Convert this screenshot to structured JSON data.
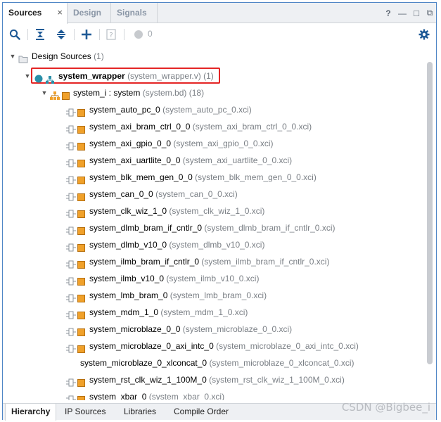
{
  "tabs": [
    {
      "label": "Sources",
      "active": true
    },
    {
      "label": "Design",
      "active": false
    },
    {
      "label": "Signals",
      "active": false
    }
  ],
  "tab_close_glyph": "×",
  "window_controls": {
    "help": "?",
    "minimize": "—",
    "maximize": "□",
    "float": "⧉"
  },
  "toolbar": {
    "icons": [
      "search-icon",
      "collapse-all-icon",
      "expand-all-icon",
      "add-icon",
      "help-doc-icon",
      "status-dot-icon",
      "gear-icon"
    ],
    "message_count": "0"
  },
  "tree": {
    "design_sources": {
      "label": "Design Sources",
      "count": "(1)"
    },
    "wrapper": {
      "name": "system_wrapper",
      "file": "(system_wrapper.v)",
      "count": "(1)"
    },
    "system_i": {
      "name": "system_i : system",
      "file": "(system.bd)",
      "count": "(18)"
    },
    "items": [
      {
        "name": "system_auto_pc_0",
        "file": "(system_auto_pc_0.xci)"
      },
      {
        "name": "system_axi_bram_ctrl_0_0",
        "file": "(system_axi_bram_ctrl_0_0.xci)"
      },
      {
        "name": "system_axi_gpio_0_0",
        "file": "(system_axi_gpio_0_0.xci)"
      },
      {
        "name": "system_axi_uartlite_0_0",
        "file": "(system_axi_uartlite_0_0.xci)"
      },
      {
        "name": "system_blk_mem_gen_0_0",
        "file": "(system_blk_mem_gen_0_0.xci)"
      },
      {
        "name": "system_can_0_0",
        "file": "(system_can_0_0.xci)"
      },
      {
        "name": "system_clk_wiz_1_0",
        "file": "(system_clk_wiz_1_0.xci)"
      },
      {
        "name": "system_dlmb_bram_if_cntlr_0",
        "file": "(system_dlmb_bram_if_cntlr_0.xci)"
      },
      {
        "name": "system_dlmb_v10_0",
        "file": "(system_dlmb_v10_0.xci)"
      },
      {
        "name": "system_ilmb_bram_if_cntlr_0",
        "file": "(system_ilmb_bram_if_cntlr_0.xci)"
      },
      {
        "name": "system_ilmb_v10_0",
        "file": "(system_ilmb_v10_0.xci)"
      },
      {
        "name": "system_lmb_bram_0",
        "file": "(system_lmb_bram_0.xci)"
      },
      {
        "name": "system_mdm_1_0",
        "file": "(system_mdm_1_0.xci)"
      },
      {
        "name": "system_microblaze_0_0",
        "file": "(system_microblaze_0_0.xci)"
      },
      {
        "name": "system_microblaze_0_axi_intc_0",
        "file": "(system_microblaze_0_axi_intc_0.xci)"
      },
      {
        "name": "system_microblaze_0_xlconcat_0",
        "file": "(system_microblaze_0_xlconcat_0.xci)",
        "no_icons": true
      },
      {
        "name": "system_rst_clk_wiz_1_100M_0",
        "file": "(system_rst_clk_wiz_1_100M_0.xci)"
      },
      {
        "name": "system_xbar_0",
        "file": "(system_xbar_0.xci)"
      }
    ]
  },
  "bottom_tabs": [
    {
      "label": "Hierarchy",
      "active": true
    },
    {
      "label": "IP Sources",
      "active": false
    },
    {
      "label": "Libraries",
      "active": false
    },
    {
      "label": "Compile Order",
      "active": false
    }
  ],
  "watermark": "CSDN @Bigbee_i",
  "colors": {
    "accent_border": "#4f86c6",
    "highlight_box": "#e42525",
    "ip_square": "#f0a12b",
    "hierarchy_icon": "#2a8fa8"
  }
}
